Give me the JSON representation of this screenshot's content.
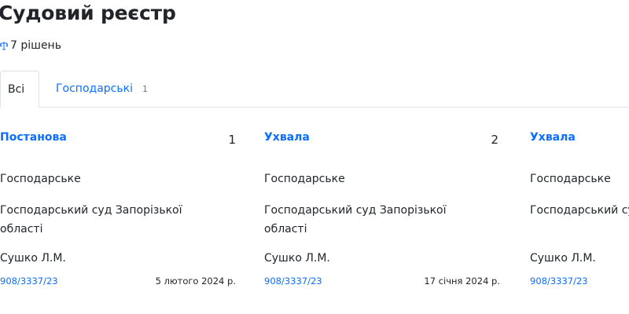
{
  "page": {
    "title": "Судовий реєстр",
    "decisions_count": "7 рішень"
  },
  "tabs": [
    {
      "label": "Всі"
    },
    {
      "label": "Господарські",
      "count": "1"
    }
  ],
  "cards": [
    {
      "type": "Постанова",
      "index": "1",
      "category": "Господарське",
      "court": "Господарський суд Запорізької області",
      "judge": "Сушко Л.М.",
      "case_number": "908/3337/23",
      "date": "5 лютого 2024 р."
    },
    {
      "type": "Ухвала",
      "index": "2",
      "category": "Господарське",
      "court": "Господарський суд Запорізької області",
      "judge": "Сушко Л.М.",
      "case_number": "908/3337/23",
      "date": "17 січня 2024 р."
    },
    {
      "type": "Ухвала",
      "index": "",
      "category": "Господарське",
      "court": "Господарський суд Запорізької області",
      "judge": "Сушко Л.М.",
      "case_number": "908/3337/23",
      "date": ""
    }
  ],
  "colors": {
    "accent": "#0d6efd",
    "text": "#212529",
    "muted": "#6c757d",
    "border": "#dee2e6"
  },
  "icons": {
    "decisions": "scales-icon"
  }
}
